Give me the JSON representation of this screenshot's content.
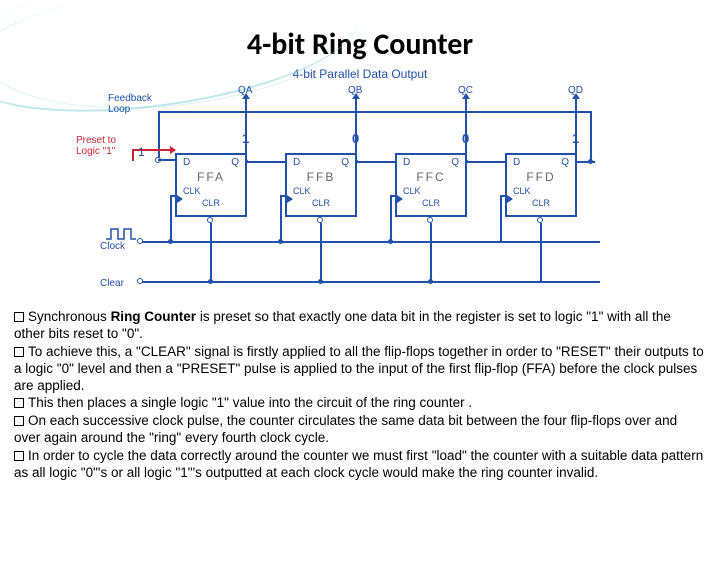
{
  "title": "4-bit Ring Counter",
  "subtitle": "4-bit Parallel Data Output",
  "diagram": {
    "feedbackLoop": "Feedback Loop",
    "presetLabel": "Preset to Logic \"1\"",
    "presetValue": "1",
    "clock": "Clock",
    "clear": "Clear",
    "outputs": {
      "qa": "QA",
      "qb": "QB",
      "qc": "QC",
      "qd": "QD"
    },
    "values": {
      "v1": "1",
      "v2": "0",
      "v3": "0",
      "v4": "1"
    },
    "ff": {
      "d": "D",
      "q": "Q",
      "clk": "CLK",
      "clr": "CLR",
      "names": {
        "a": "FFA",
        "b": "FFB",
        "c": "FFC",
        "d": "FFD"
      }
    }
  },
  "bullets": {
    "b1a": "Synchronous ",
    "b1bold": "Ring Counter",
    "b1b": " is preset so that exactly one data bit in the register is set to logic \"1\" with all the other bits reset to \"0\".",
    "b2": "To achieve this, a \"CLEAR\" signal is firstly applied to all the flip-flops together in order to \"RESET\" their outputs to a logic \"0\" level and then a \"PRESET\" pulse is applied to the input of the first flip-flop (FFA) before the clock pulses are applied.",
    "b3": "This then places a single logic \"1\" value into the circuit of the ring counter .",
    "b4": "On each successive clock pulse, the counter circulates the same data bit between the four flip-flops over and over again around the \"ring\" every fourth clock cycle.",
    "b5": "In order to cycle the data correctly around the counter we must first \"load\" the counter with a suitable data pattern as all logic \"0\"'s or all logic \"1\"'s outputted at each clock cycle would make the ring counter invalid."
  }
}
